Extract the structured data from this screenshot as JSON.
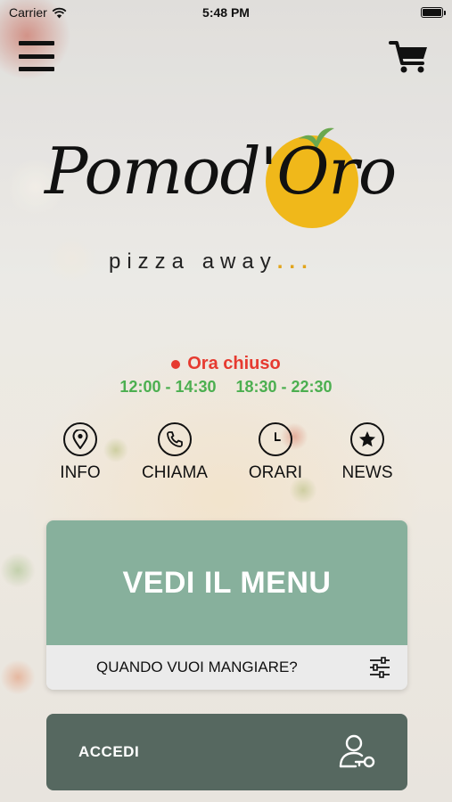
{
  "status_bar": {
    "carrier": "Carrier",
    "time": "5:48 PM",
    "battery_level": 1.0
  },
  "nav": {
    "menu_icon": "hamburger-menu-icon",
    "cart_icon": "shopping-cart-icon"
  },
  "brand": {
    "name": "Pomod'Oro",
    "tagline": "pizza away",
    "tagline_dots": "...",
    "accent": "#f0b81a"
  },
  "restaurant_status": {
    "label": "Ora chiuso",
    "color": "#e63a30",
    "hours": [
      "12:00 - 14:30",
      "18:30 - 22:30"
    ],
    "hours_color": "#4caf50"
  },
  "actions": [
    {
      "label": "INFO",
      "icon": "location-pin-icon"
    },
    {
      "label": "CHIAMA",
      "icon": "phone-icon"
    },
    {
      "label": "ORARI",
      "icon": "clock-icon"
    },
    {
      "label": "NEWS",
      "icon": "star-icon"
    }
  ],
  "menu_card": {
    "title": "VEDI IL MENU",
    "when_label": "QUANDO VUOI MANGIARE?",
    "when_icon": "filter-sliders-icon",
    "color": "#87b09c"
  },
  "login": {
    "label": "ACCEDI",
    "icon": "user-key-icon",
    "color": "#566860"
  }
}
